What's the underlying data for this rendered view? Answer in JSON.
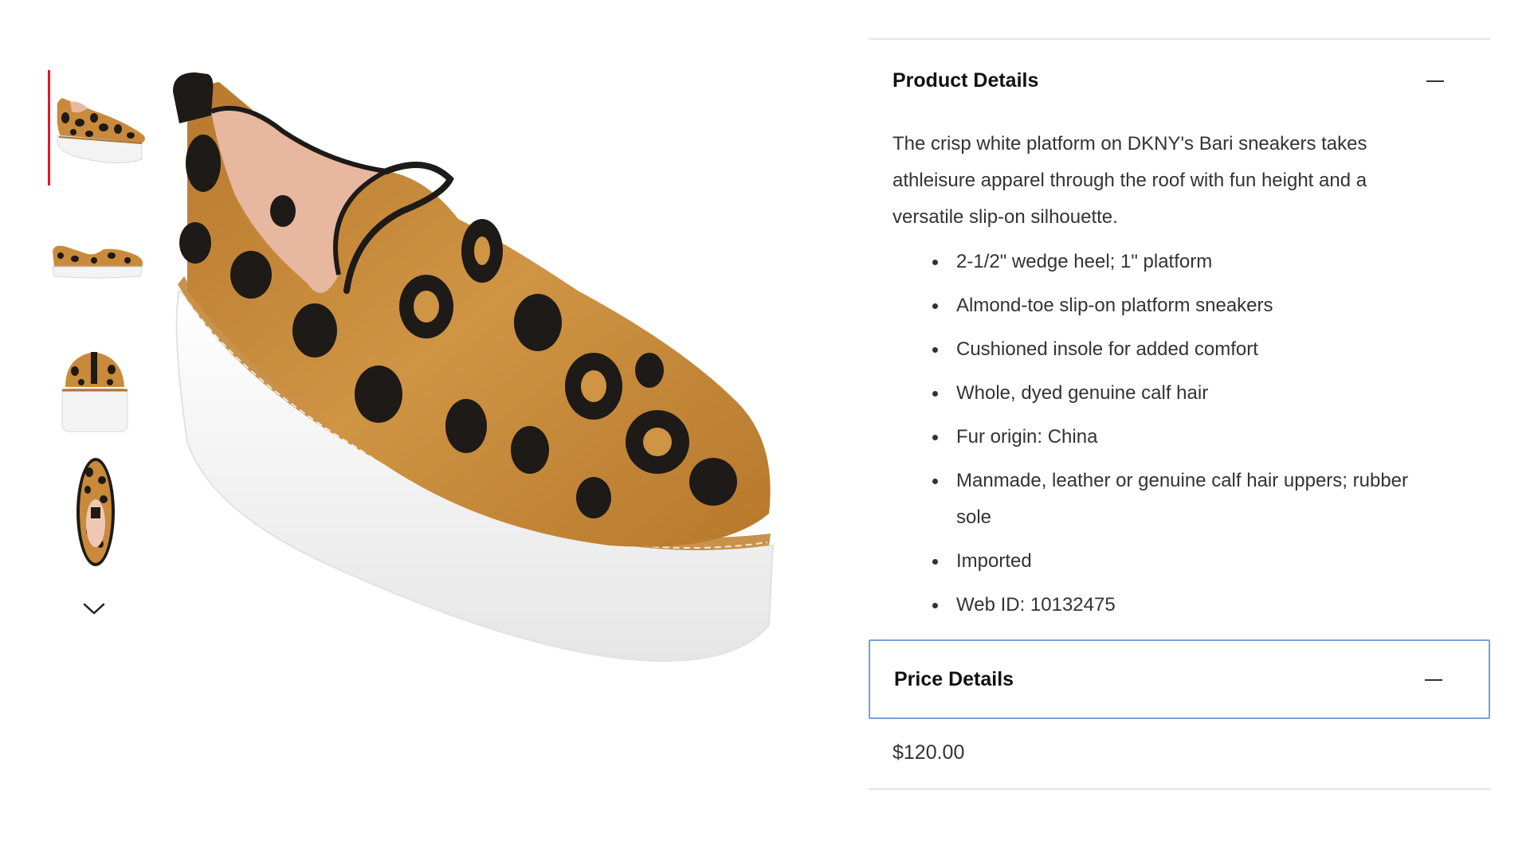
{
  "gallery": {
    "thumbnails": [
      {
        "alt": "thumbnail-angled-view",
        "active": true
      },
      {
        "alt": "thumbnail-side-view",
        "active": false
      },
      {
        "alt": "thumbnail-back-view",
        "active": false
      },
      {
        "alt": "thumbnail-top-view",
        "active": false
      }
    ],
    "scroll_down_icon": "chevron-down-icon",
    "accent_color": "#e01a2b"
  },
  "product_details": {
    "title": "Product Details",
    "toggle_icon": "minus-icon",
    "description": "The crisp white platform on DKNY's Bari sneakers takes athleisure apparel through the roof with fun height and a versatile slip-on silhouette.",
    "bullets": [
      "2-1/2\" wedge heel; 1\" platform",
      "Almond-toe slip-on platform sneakers",
      "Cushioned insole for added comfort",
      "Whole, dyed genuine calf hair",
      "Fur origin: China",
      "Manmade, leather or genuine calf hair uppers; rubber sole",
      "Imported",
      "Web ID: 10132475"
    ]
  },
  "price_details": {
    "title": "Price Details",
    "toggle_icon": "minus-icon",
    "price": "$120.00",
    "focus_color": "#7a9fd6"
  }
}
